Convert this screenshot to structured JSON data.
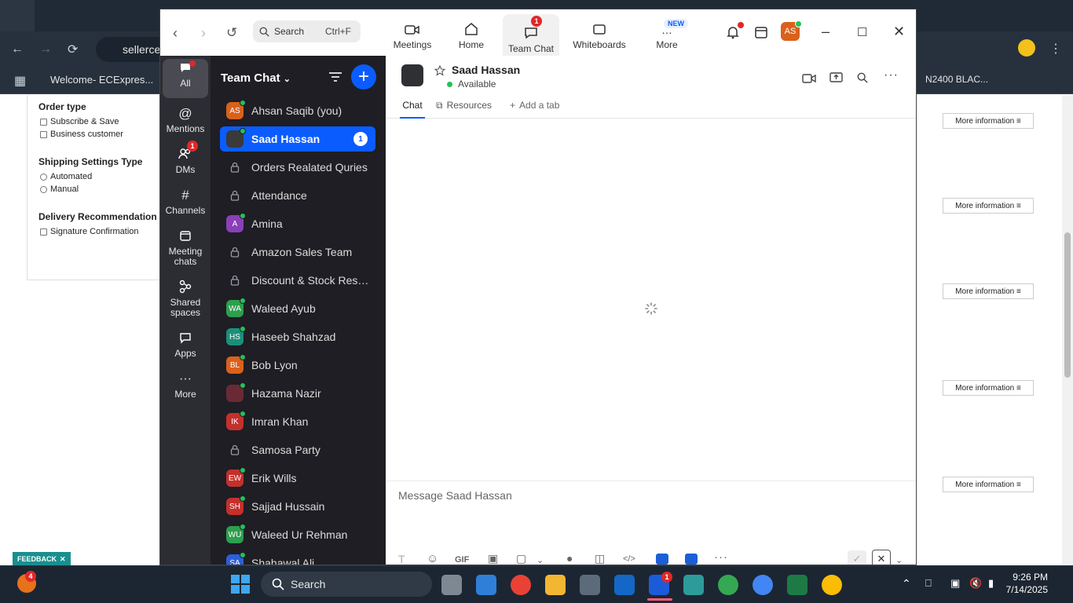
{
  "browser": {
    "address_prefix": "sellerce",
    "bookmark": "Welcome- ECExpres...",
    "bm_right": "N2400 BLAC..."
  },
  "bg_page": {
    "order_type": "Order type",
    "order_opts": [
      "Subscribe & Save",
      "Business customer"
    ],
    "shipping_title": "Shipping Settings Type",
    "shipping_opts": [
      "Automated",
      "Manual"
    ],
    "delivery_title": "Delivery Recommendation",
    "delivery_opts": [
      "Signature Confirmation"
    ],
    "more_info": "More information",
    "feedback": "FEEDBACK",
    "feedback_count": "4"
  },
  "zoom": {
    "search_placeholder": "Search",
    "search_shortcut": "Ctrl+F",
    "tabs": [
      {
        "label": "Meetings"
      },
      {
        "label": "Home"
      },
      {
        "label": "Team Chat",
        "badge": "1"
      },
      {
        "label": "Whiteboards"
      },
      {
        "label": "More",
        "badge": "NEW"
      }
    ],
    "avatar_initials": "AS",
    "rail": [
      {
        "label": "All"
      },
      {
        "label": "Mentions"
      },
      {
        "label": "DMs",
        "badge": "1"
      },
      {
        "label": "Channels"
      },
      {
        "label": "Meeting chats"
      },
      {
        "label": "Shared spaces"
      },
      {
        "label": "Apps"
      },
      {
        "label": "More"
      }
    ],
    "list_title": "Team Chat",
    "items": [
      {
        "name": "Ahsan Saqib (you)",
        "initials": "AS",
        "color": "#d9611c",
        "online": true,
        "kind": "user"
      },
      {
        "name": "Saad Hassan",
        "initials": "",
        "color": "#3a3a3a",
        "online": true,
        "kind": "user",
        "badge": "1",
        "active": true
      },
      {
        "name": "Orders Realated Quries",
        "kind": "lock"
      },
      {
        "name": "Attendance",
        "kind": "lock"
      },
      {
        "name": "Amina",
        "initials": "A",
        "color": "#8b3fb8",
        "online": true,
        "kind": "user"
      },
      {
        "name": "Amazon Sales Team",
        "kind": "lock"
      },
      {
        "name": "Discount & Stock Reser...",
        "kind": "lock"
      },
      {
        "name": "Waleed Ayub",
        "initials": "WA",
        "color": "#2e9e4f",
        "online": true,
        "kind": "user"
      },
      {
        "name": "Haseeb Shahzad",
        "initials": "HS",
        "color": "#1c8f7a",
        "online": true,
        "kind": "user"
      },
      {
        "name": "Bob Lyon",
        "initials": "BL",
        "color": "#d9611c",
        "online": true,
        "kind": "user"
      },
      {
        "name": "Hazama Nazir",
        "initials": "",
        "color": "#6a2a35",
        "online": true,
        "kind": "user"
      },
      {
        "name": "Imran Khan",
        "initials": "IK",
        "color": "#c4302b",
        "online": true,
        "kind": "user"
      },
      {
        "name": "Samosa Party",
        "kind": "lock"
      },
      {
        "name": "Erik Wills",
        "initials": "EW",
        "color": "#c4302b",
        "online": true,
        "kind": "user"
      },
      {
        "name": "Sajjad Hussain",
        "initials": "SH",
        "color": "#c4302b",
        "online": true,
        "kind": "user"
      },
      {
        "name": "Waleed Ur Rehman",
        "initials": "WU",
        "color": "#2e9e4f",
        "online": true,
        "kind": "user"
      },
      {
        "name": "Shahawal Ali",
        "initials": "SA",
        "color": "#2b5fd9",
        "online": true,
        "kind": "user"
      }
    ],
    "chat": {
      "contact": "Saad Hassan",
      "status": "Available",
      "tab_chat": "Chat",
      "tab_resources": "Resources",
      "tab_add": "Add a tab",
      "placeholder": "Message Saad Hassan",
      "gif": "GIF"
    }
  },
  "taskbar": {
    "search": "Search",
    "time": "9:26 PM",
    "date": "7/14/2025",
    "zoom_badge": "1"
  }
}
